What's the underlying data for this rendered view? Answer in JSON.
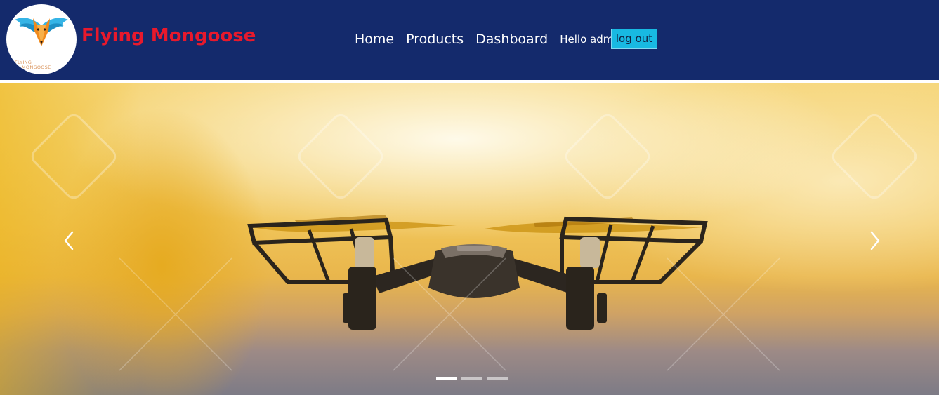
{
  "brand": {
    "name": "Flying Mongoose",
    "logo_text_line1": "FLYING",
    "logo_text_line2": "MONGOOSE"
  },
  "nav": {
    "items": [
      {
        "label": "Home"
      },
      {
        "label": "Products"
      },
      {
        "label": "Dashboard"
      }
    ],
    "greeting": "Hello admin",
    "logout_label": "log out"
  },
  "carousel": {
    "slide_count": 3,
    "active_index": 0,
    "prev_icon": "chevron-left-icon",
    "next_icon": "chevron-right-icon",
    "slide_image": "drone-at-sunset"
  },
  "colors": {
    "navbar": "#142a6c",
    "brand": "#e8192c",
    "logout_button": "#18b9e2",
    "nav_text": "#ffffff"
  }
}
